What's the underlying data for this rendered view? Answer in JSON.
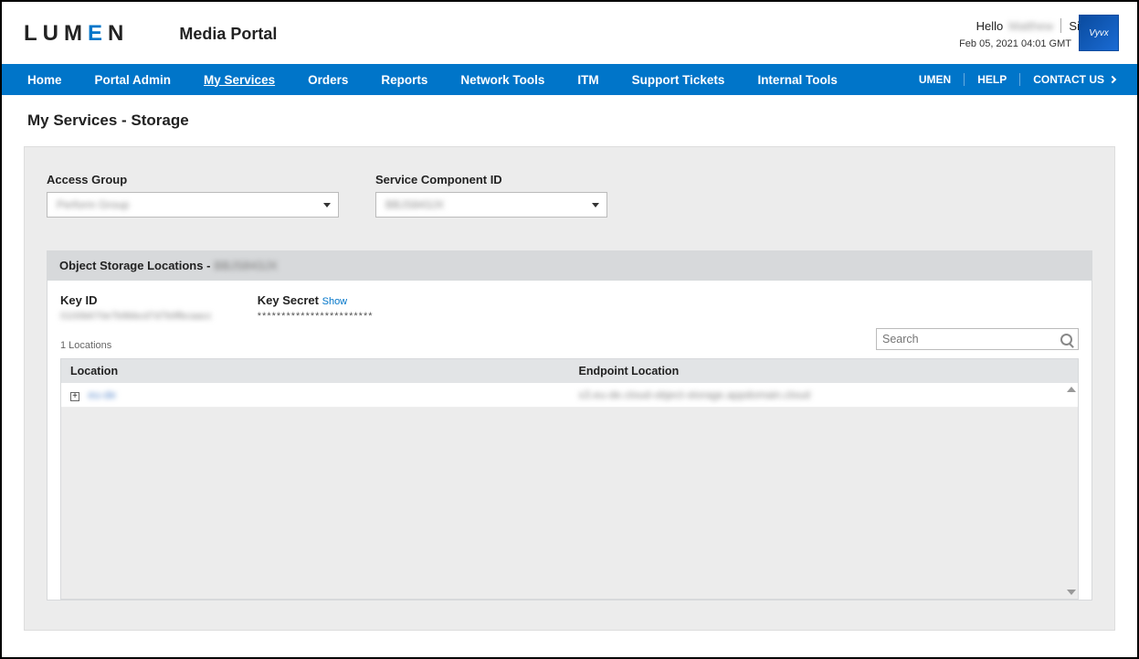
{
  "header": {
    "brand_pre": "LUM",
    "brand_accent": "E",
    "brand_post": "N",
    "portal_title": "Media Portal",
    "greeting": "Hello",
    "user_name": "Matthew",
    "sign_out": "Sign Out",
    "timestamp": "Feb 05, 2021 04:01 GMT",
    "partner_logo": "Vyvx"
  },
  "nav": {
    "items": [
      "Home",
      "Portal Admin",
      "My Services",
      "Orders",
      "Reports",
      "Network Tools",
      "ITM",
      "Support Tickets",
      "Internal Tools"
    ],
    "active_index": 2,
    "right": [
      "UMEN",
      "HELP",
      "CONTACT US"
    ]
  },
  "page": {
    "title": "My Services - Storage"
  },
  "filters": {
    "access_group": {
      "label": "Access Group",
      "value": "Perform Group"
    },
    "service_component": {
      "label": "Service Component ID",
      "value": "BBJS843JX"
    }
  },
  "section": {
    "title_prefix": "Object Storage Locations - ",
    "title_id": "BBJS843JX",
    "key_id_label": "Key ID",
    "key_id_value": "0100b670e7b9bbcd7d7b9fbcaacc",
    "key_secret_label": "Key Secret",
    "key_secret_show": "Show",
    "key_secret_value": "************************",
    "locations_count": "1 Locations",
    "search_placeholder": "Search"
  },
  "table": {
    "columns": [
      "Location",
      "Endpoint Location"
    ],
    "rows": [
      {
        "location": "eu-de",
        "endpoint": "s3.eu-de.cloud-object-storage.appdomain.cloud"
      }
    ]
  }
}
